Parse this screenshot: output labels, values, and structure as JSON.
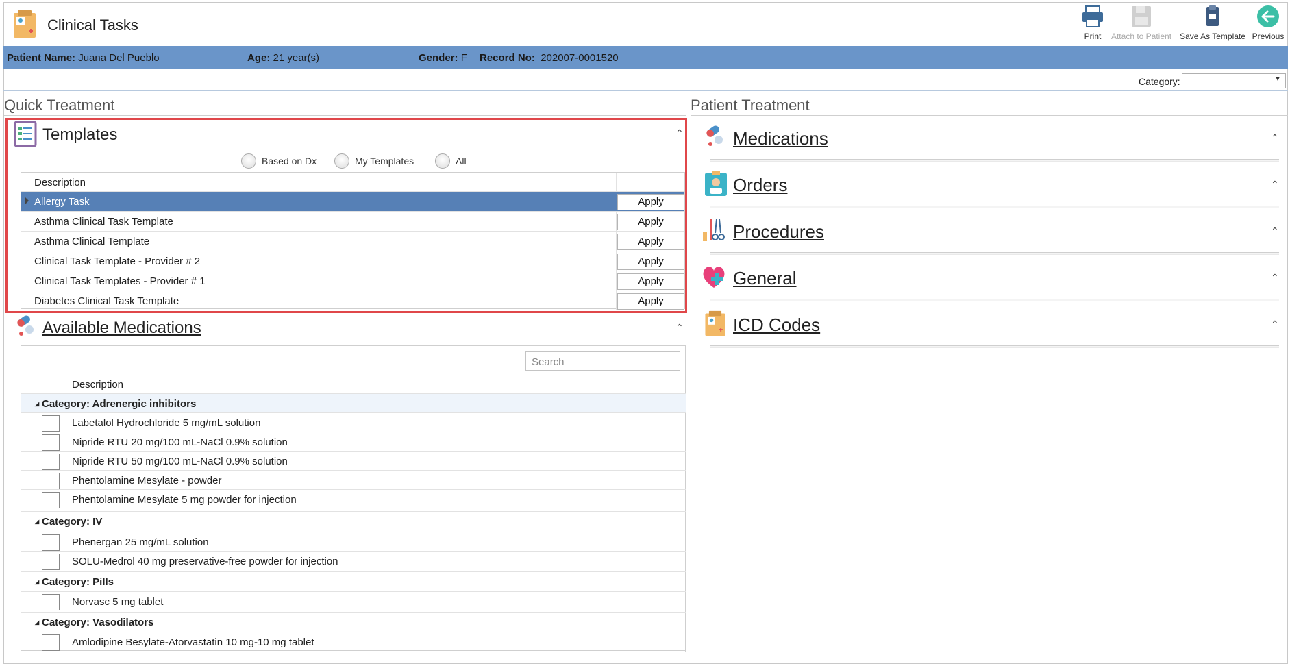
{
  "header": {
    "title": "Clinical Tasks",
    "toolbar": {
      "print": "Print",
      "attach": "Attach to Patient",
      "save_template": "Save As Template",
      "previous": "Previous"
    }
  },
  "patient": {
    "name_label": "Patient Name:",
    "name": "Juana Del Pueblo",
    "age_label": "Age:",
    "age": "21 year(s)",
    "gender_label": "Gender:",
    "gender": "F",
    "record_label": "Record No:",
    "record": "202007-0001520"
  },
  "category_filter": {
    "label": "Category:",
    "value": ""
  },
  "quick_treatment": {
    "title": "Quick Treatment",
    "templates": {
      "title": "Templates",
      "radios": [
        "Based on Dx",
        "My Templates",
        "All"
      ],
      "column_description": "Description",
      "apply_label": "Apply",
      "rows": [
        "Allergy Task",
        "Asthma Clinical Task Template",
        "Asthma Clinical Template",
        "Clinical Task Template - Provider # 2",
        "Clinical Task Templates - Provider # 1",
        "Diabetes Clinical Task Template"
      ]
    },
    "available_medications": {
      "title": "Available Medications",
      "search_placeholder": "Search",
      "column_description": "Description",
      "categories": [
        {
          "label": "Category: Adrenergic inhibitors",
          "items": [
            "Labetalol Hydrochloride 5 mg/mL solution",
            "Nipride RTU 20 mg/100 mL-NaCl 0.9% solution",
            "Nipride RTU 50 mg/100 mL-NaCl 0.9% solution",
            "Phentolamine Mesylate - powder",
            "Phentolamine Mesylate 5 mg powder for injection"
          ]
        },
        {
          "label": "Category: IV",
          "items": [
            "Phenergan 25 mg/mL solution",
            "SOLU-Medrol 40 mg preservative-free powder for injection"
          ]
        },
        {
          "label": "Category: Pills",
          "items": [
            "Norvasc 5 mg tablet"
          ]
        },
        {
          "label": "Category: Vasodilators",
          "items": [
            "Amlodipine Besylate-Atorvastatin 10 mg-10 mg tablet"
          ]
        }
      ]
    }
  },
  "patient_treatment": {
    "title": "Patient Treatment",
    "sections": [
      "Medications",
      "Orders",
      "Procedures",
      "General",
      "ICD Codes"
    ]
  },
  "colors": {
    "patient_bar": "#6a95c9",
    "selected_row": "#5680b6",
    "highlight_border": "#e0474a"
  }
}
